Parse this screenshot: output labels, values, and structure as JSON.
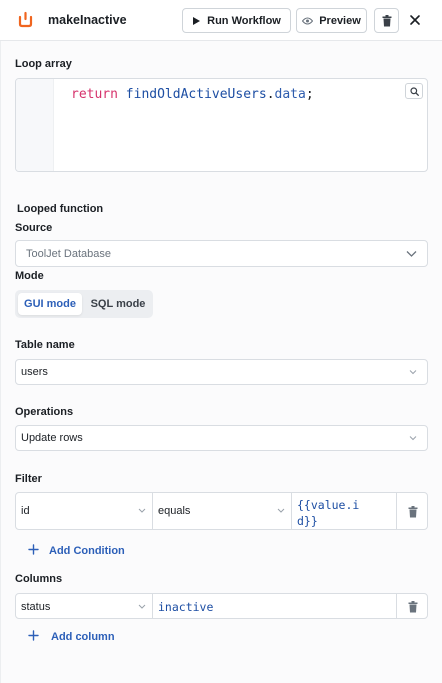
{
  "header": {
    "title": "makeInactive",
    "run_label": "Run Workflow",
    "preview_label": "Preview",
    "brand_color": "#f0651f"
  },
  "loop": {
    "label": "Loop array",
    "code_keyword": "return",
    "code_identifier": "findOldActiveUsers",
    "code_dot": ".",
    "code_property": "data",
    "code_end": ";"
  },
  "looped": {
    "label": "Looped function",
    "source_label": "Source",
    "source_value": "ToolJet Database",
    "mode_label": "Mode",
    "modes": [
      "GUI mode",
      "SQL mode"
    ],
    "active_mode": "GUI mode"
  },
  "table": {
    "label": "Table name",
    "value": "users"
  },
  "operations": {
    "label": "Operations",
    "value": "Update rows"
  },
  "filter": {
    "label": "Filter",
    "column": "id",
    "operator": "equals",
    "value_line1": "{{value.i",
    "value_line2": "d}}",
    "add_label": "Add Condition"
  },
  "columns": {
    "label": "Columns",
    "column": "status",
    "value": "inactive",
    "add_label": "Add column"
  },
  "icons": [
    "tooljet-icon",
    "play-icon",
    "eye-icon",
    "trash-icon",
    "close-icon",
    "search-icon",
    "chevron-down-icon",
    "plus-icon"
  ]
}
